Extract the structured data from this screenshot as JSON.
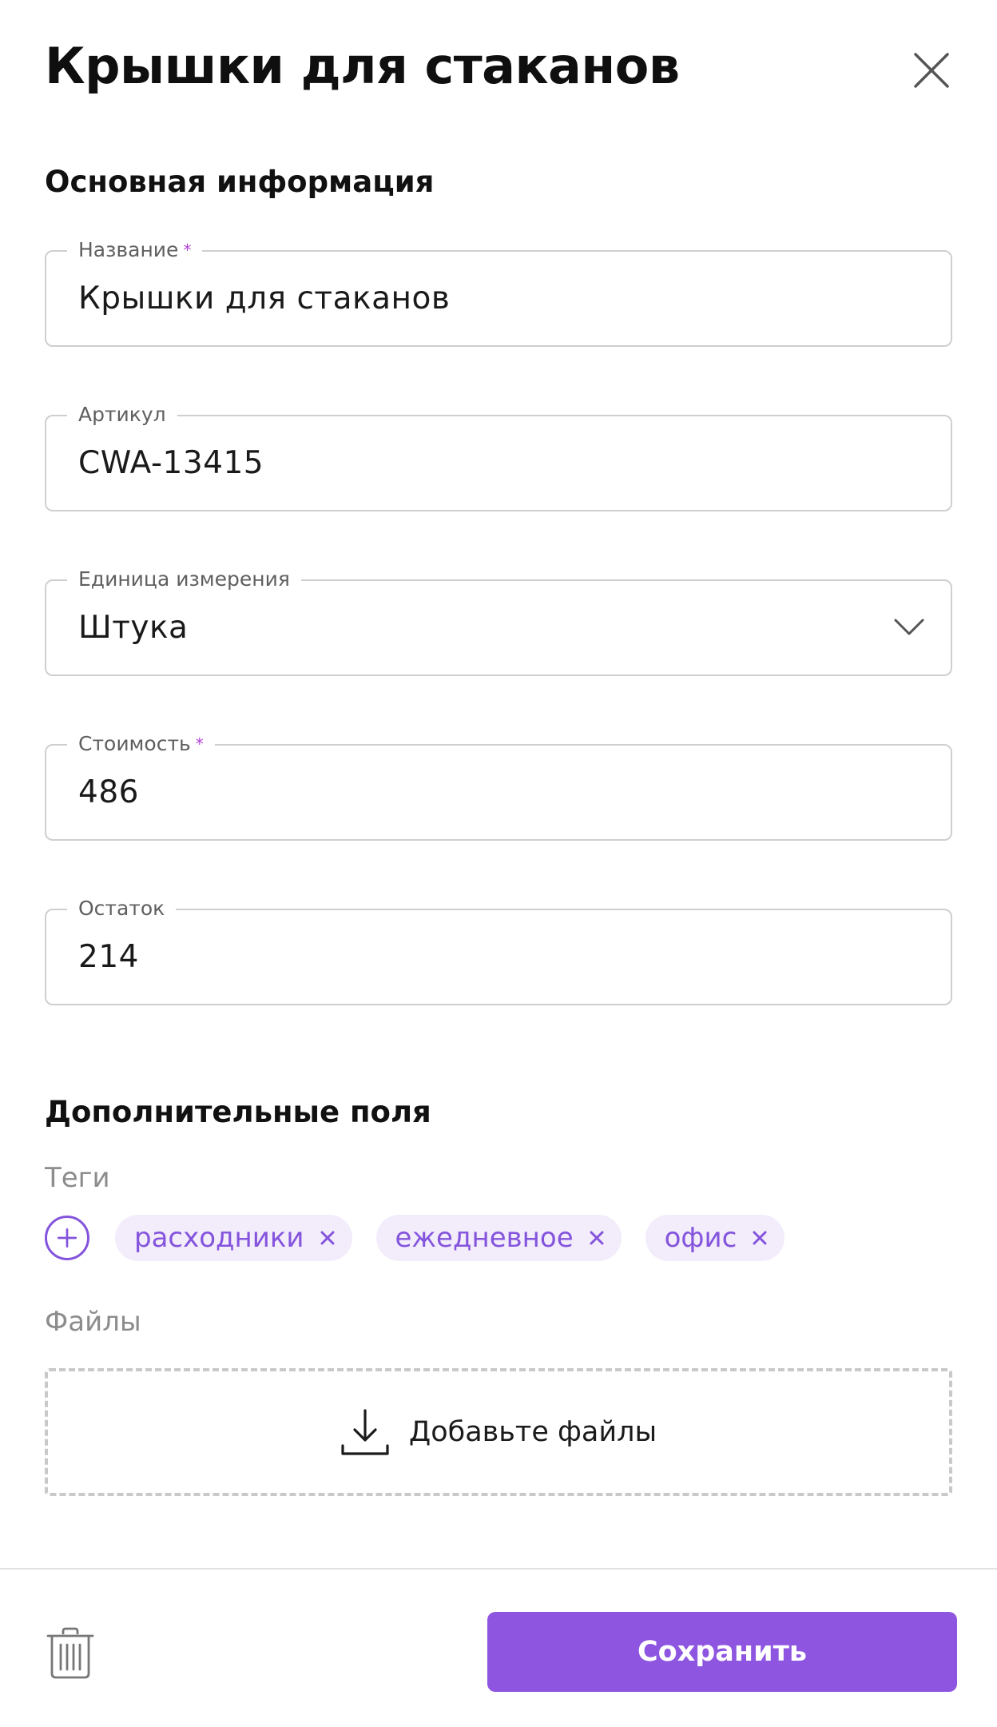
{
  "header": {
    "title": "Крышки для стаканов",
    "close_icon": "close-icon"
  },
  "basic": {
    "section_title": "Основная информация",
    "fields": [
      {
        "label": "Название",
        "required": "*",
        "value": "Крышки для стаканов"
      },
      {
        "label": "Артикул",
        "value": "CWA-13415"
      },
      {
        "label": "Единица измерения",
        "value": "Штука",
        "icon": "chevron-down-icon"
      },
      {
        "label": "Стоимость",
        "required": "*",
        "value": "486"
      },
      {
        "label": "Остаток",
        "value": "214"
      }
    ]
  },
  "extra": {
    "section_title": "Дополнительные поля",
    "tags_label": "Теги",
    "tags": [
      "расходники",
      "ежедневное",
      "офис"
    ],
    "files_label": "Файлы",
    "dropzone_text": "Добавьте файлы",
    "dropzone_icon": "download-icon"
  },
  "footer": {
    "delete_icon": "trash-icon",
    "save_label": "Сохранить"
  },
  "colors": {
    "accent": "#8e56e0",
    "tag_bg": "#f2ecfb",
    "tag_text": "#8454dd",
    "required": "#b23fd6",
    "border": "#cfcfcf"
  }
}
